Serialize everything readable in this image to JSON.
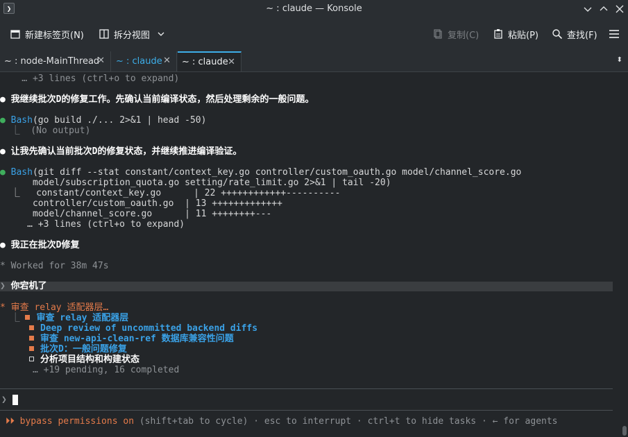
{
  "window": {
    "title": "~ : claude — Konsole",
    "icon": "terminal-icon",
    "buttons": [
      "chevron-down-icon",
      "chevron-up-icon",
      "close-icon"
    ]
  },
  "toolbar": {
    "new_tab_label": "新建标签页(N)",
    "split_view_label": "拆分视图",
    "copy_label": "复制(C)",
    "paste_label": "粘贴(P)",
    "find_label": "查找(F)"
  },
  "tabs": [
    {
      "label": "~ : node-MainThread"
    },
    {
      "label": "~ : claude"
    },
    {
      "label": "~ : claude"
    }
  ],
  "terminal": {
    "lines": {
      "l0": "    … +3 lines (ctrl+o to expand)",
      "l1_bullet": "●",
      "l1_text": " 我继续批次D的修复工作。先确认当前编译状态，然后处理剩余的一般问题。",
      "l2_bullet": "●",
      "l2_tool": " Bash",
      "l2_cmd": "(go build ./... 2>&1 | head -50)",
      "l3": "  ⎿  (No output)",
      "l4_bullet": "●",
      "l4_text": " 让我先确认当前批次D的修复状态，并继续推进编译验证。",
      "l5_bullet": "●",
      "l5_tool": " Bash",
      "l5_cmd": "(git diff --stat constant/context_key.go controller/custom_oauth.go model/channel_score.go",
      "l6": "      model/subscription_quota.go setting/rate_limit.go 2>&1 | tail -20)",
      "l7": "  ⎿   constant/context_key.go      | 22 ++++++++++++----------",
      "l8": "      controller/custom_oauth.go  | 13 +++++++++++++",
      "l9": "      model/channel_score.go      | 11 ++++++++---",
      "l10": "     … +3 lines (ctrl+o to expand)",
      "l11_bullet": "●",
      "l11_text": " 我正在批次D修复",
      "l12": "* Worked for 38m 47s",
      "l13_prompt": "❯",
      "l13_text": " 你宕机了",
      "l14_star": "*",
      "l14_text": " 审查 relay 适配器层…",
      "l15_prefix": "  ⎿ ",
      "l15_text": "审查 relay 适配器层",
      "l16_text": "Deep review of uncommitted backend diffs",
      "l17_text": "审查 new-api-clean-ref 数据库兼容性问题",
      "l18_text": "批次D：一般问题修复",
      "l19_text": "分析项目结构和构建状态",
      "l20": "      … +19 pending, 16 completed",
      "prompt": "❯",
      "status_arrows": " ⏵⏵ ",
      "status_mode": "bypass permissions on",
      "status_rest": " (shift+tab to cycle) · esc to interrupt · ctrl+t to hide tasks · ← for agents"
    }
  },
  "colors": {
    "background": "#232629",
    "accent": "#3daee9",
    "success": "#3fae5d",
    "tool": "#3aa1e6",
    "active_task": "#e57b4a"
  }
}
